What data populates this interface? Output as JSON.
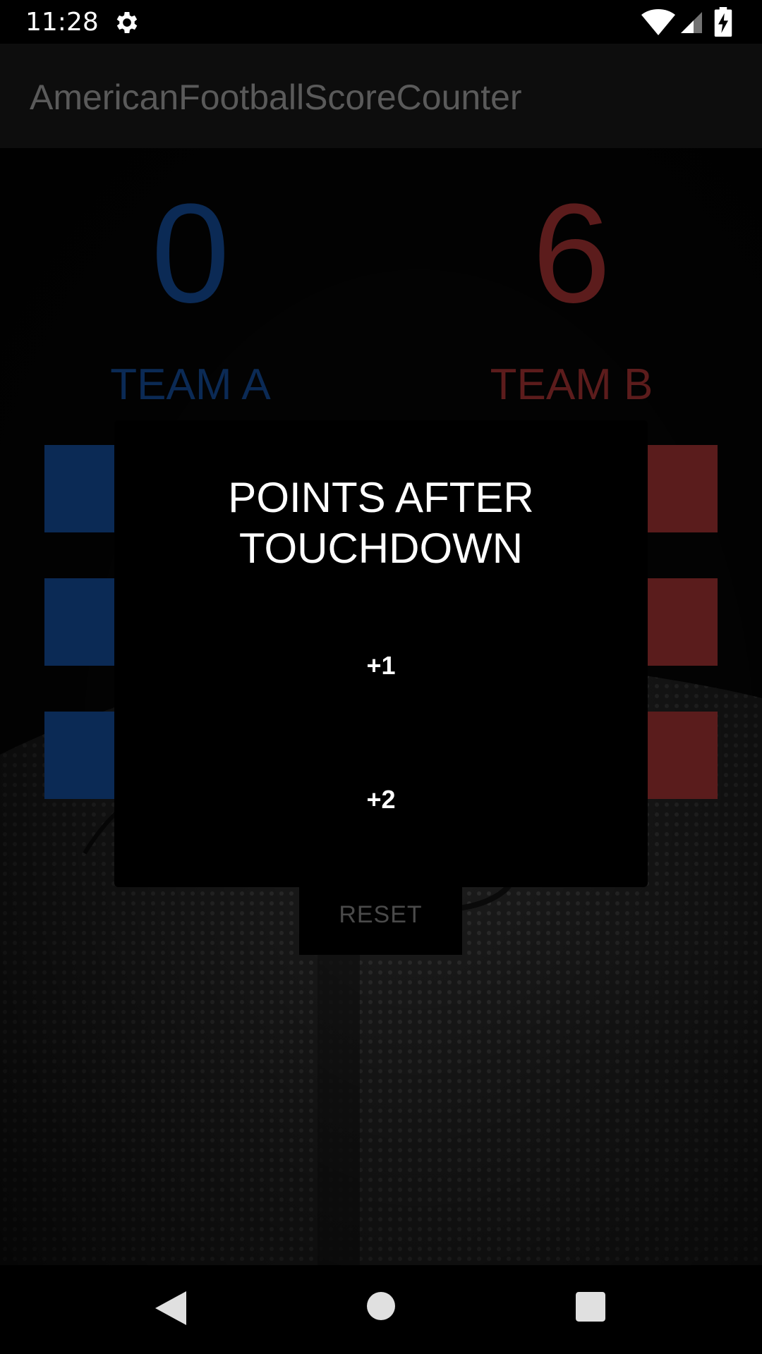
{
  "status_bar": {
    "time": "11:28",
    "icons": [
      "gear-icon",
      "wifi-icon",
      "signal-icon",
      "battery-charging-icon"
    ]
  },
  "app_bar": {
    "title": "AmericanFootballScoreCounter"
  },
  "scoreboard": {
    "team_a": {
      "score": "0",
      "name": "TEAM A",
      "color": "#0b2a55"
    },
    "team_b": {
      "score": "6",
      "name": "TEAM B",
      "color": "#5c1c1c"
    }
  },
  "reset": {
    "label": "RESET"
  },
  "dialog": {
    "title": "POINTS AFTER TOUCHDOWN",
    "options": [
      {
        "label": "+1"
      },
      {
        "label": "+2"
      }
    ]
  },
  "nav_bar": {
    "icons": [
      "back-icon",
      "home-icon",
      "recents-icon"
    ]
  }
}
